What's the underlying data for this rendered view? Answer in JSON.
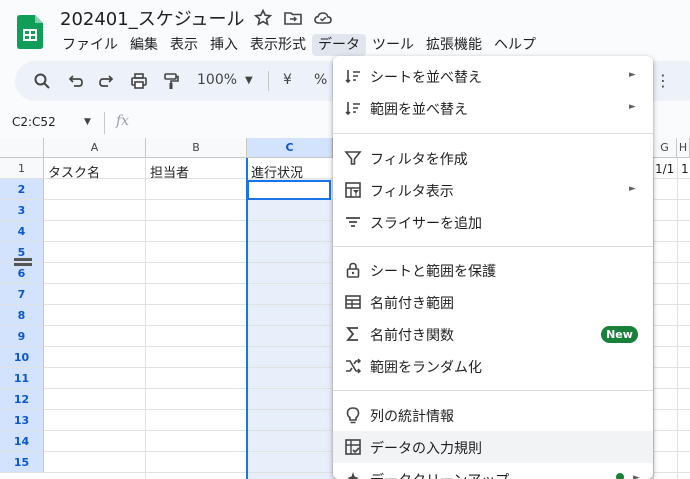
{
  "document": {
    "title": "202401_スケジュール"
  },
  "menubar": [
    {
      "label": "ファイル",
      "active": false
    },
    {
      "label": "編集",
      "active": false
    },
    {
      "label": "表示",
      "active": false
    },
    {
      "label": "挿入",
      "active": false
    },
    {
      "label": "表示形式",
      "active": false
    },
    {
      "label": "データ",
      "active": true
    },
    {
      "label": "ツール",
      "active": false
    },
    {
      "label": "拡張機能",
      "active": false
    },
    {
      "label": "ヘルプ",
      "active": false
    }
  ],
  "toolbar": {
    "zoom": "100%",
    "currency": "¥",
    "percent": "%",
    "icons": [
      "search-icon",
      "undo-icon",
      "redo-icon",
      "print-icon",
      "paint-format-icon",
      "more-icon"
    ]
  },
  "formula_bar": {
    "name_box": "C2:C52",
    "fx": "fx"
  },
  "grid": {
    "columns": [
      {
        "label": "A",
        "selected": false
      },
      {
        "label": "B",
        "selected": false
      },
      {
        "label": "C",
        "selected": true
      },
      {
        "label": "G",
        "selected": false
      },
      {
        "label": "H",
        "selected": false
      }
    ],
    "rows": [
      "1",
      "2",
      "3",
      "4",
      "5",
      "6",
      "7",
      "8",
      "9",
      "10",
      "11",
      "12",
      "13",
      "14",
      "15"
    ],
    "selected_rows": [
      "2",
      "3",
      "4",
      "5",
      "6",
      "7",
      "8",
      "9",
      "10",
      "11",
      "12",
      "13",
      "14",
      "15"
    ],
    "row1": {
      "a": "タスク名",
      "b": "担当者",
      "c": "進行状況",
      "g": "1/1",
      "h": "1"
    }
  },
  "data_menu": {
    "items": [
      {
        "label": "シートを並べ替え",
        "icon": "sort-icon",
        "submenu": true
      },
      {
        "label": "範囲を並べ替え",
        "icon": "sort-range-icon",
        "submenu": true
      },
      {
        "label": "フィルタを作成",
        "icon": "filter-icon",
        "submenu": false
      },
      {
        "label": "フィルタ表示",
        "icon": "filter-views-icon",
        "submenu": true
      },
      {
        "label": "スライサーを追加",
        "icon": "slicer-icon",
        "submenu": false
      },
      {
        "label": "シートと範囲を保護",
        "icon": "lock-icon",
        "submenu": false
      },
      {
        "label": "名前付き範囲",
        "icon": "named-range-icon",
        "submenu": false
      },
      {
        "label": "名前付き関数",
        "icon": "sigma-icon",
        "submenu": false,
        "badge": "New"
      },
      {
        "label": "範囲をランダム化",
        "icon": "shuffle-icon",
        "submenu": false
      },
      {
        "label": "列の統計情報",
        "icon": "lightbulb-icon",
        "submenu": false
      },
      {
        "label": "データの入力規則",
        "icon": "data-validation-icon",
        "submenu": false,
        "highlighted": true
      },
      {
        "label": "データクリーンアップ",
        "icon": "cleanup-icon",
        "submenu": true
      }
    ]
  },
  "colors": {
    "accent": "#1a73e8",
    "badge": "#188038",
    "sheets_green": "#0f9d58"
  }
}
